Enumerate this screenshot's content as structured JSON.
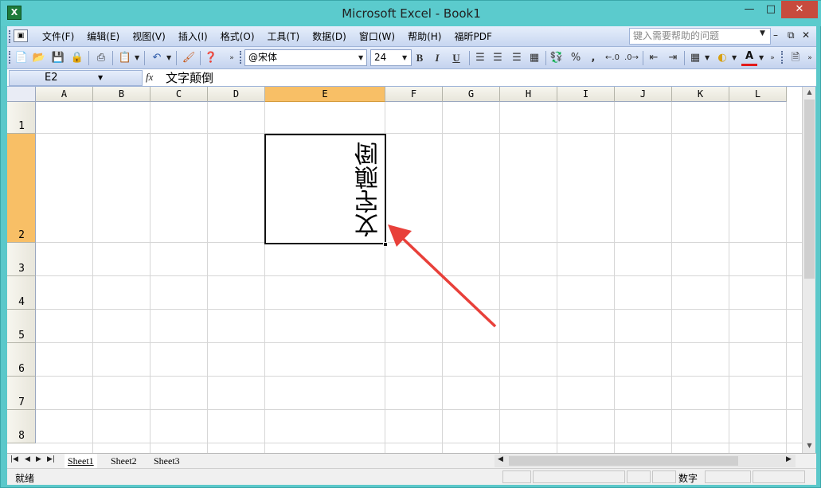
{
  "window": {
    "title": "Microsoft Excel - Book1",
    "app_icon": "excel-icon"
  },
  "menu": {
    "items": [
      "文件(F)",
      "编辑(E)",
      "视图(V)",
      "插入(I)",
      "格式(O)",
      "工具(T)",
      "数据(D)",
      "窗口(W)",
      "帮助(H)",
      "福昕PDF"
    ],
    "help_placeholder": "键入需要帮助的问题"
  },
  "toolbar": {
    "font_name": "@宋体",
    "font_size": "24",
    "bold": "B",
    "italic": "I",
    "underline": "U",
    "percent": "%",
    "comma": ","
  },
  "formula_bar": {
    "name_box": "E2",
    "fx": "fx",
    "content": "文字颠倒"
  },
  "grid": {
    "columns": [
      "A",
      "B",
      "C",
      "D",
      "E",
      "F",
      "G",
      "H",
      "I",
      "J",
      "K",
      "L"
    ],
    "rows": [
      "1",
      "2",
      "3",
      "4",
      "5",
      "6",
      "7",
      "8"
    ],
    "selected_column": "E",
    "selected_row": "2",
    "active_cell_text": "文字颠倒"
  },
  "sheets": {
    "tabs": [
      "Sheet1",
      "Sheet2",
      "Sheet3"
    ],
    "active": "Sheet1"
  },
  "status": {
    "left": "就绪",
    "mode": "数字"
  },
  "colors": {
    "selection": "#f8bf66",
    "arrow": "#e8403a",
    "titlebar": "#5bcbcd"
  }
}
